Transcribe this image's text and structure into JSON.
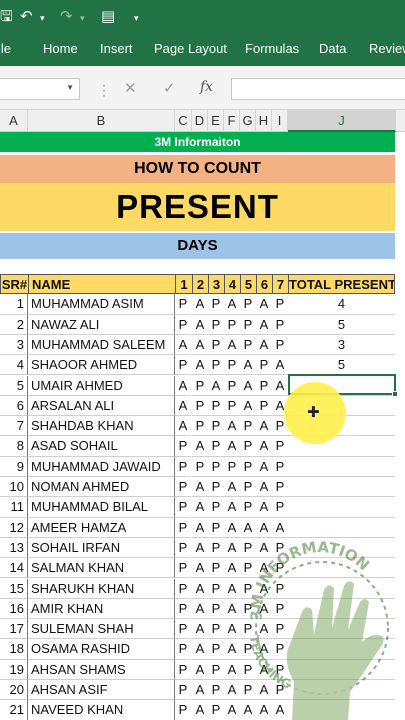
{
  "quick_access": {
    "save_icon": "save-icon",
    "undo_icon": "undo-icon",
    "redo_icon": "redo-icon",
    "form_icon": "form-icon",
    "customize_icon": "customize-qat-icon"
  },
  "ribbon": {
    "tabs": [
      "ile",
      "Home",
      "Insert",
      "Page Layout",
      "Formulas",
      "Data",
      "Review"
    ]
  },
  "formula_bar": {
    "name_box": "",
    "cancel_icon": "✕",
    "enter_icon": "✓",
    "fx_label": "fx",
    "value": ""
  },
  "columns": [
    "A",
    "B",
    "C",
    "D",
    "E",
    "F",
    "G",
    "H",
    "I",
    "J"
  ],
  "sheet": {
    "brand": "3M Informaiton",
    "line1": "HOW TO COUNT",
    "line2": "PRESENT",
    "line3": "DAYS",
    "headers": [
      "SR#",
      "NAME",
      "1",
      "2",
      "3",
      "4",
      "5",
      "6",
      "7",
      "TOTAL PRESENT"
    ],
    "rows": [
      {
        "sr": "1",
        "name": "MUHAMMAD ASIM",
        "days": [
          "P",
          "A",
          "P",
          "A",
          "P",
          "A",
          "P"
        ],
        "total": "4"
      },
      {
        "sr": "2",
        "name": "NAWAZ ALI",
        "days": [
          "P",
          "A",
          "P",
          "P",
          "P",
          "A",
          "P"
        ],
        "total": "5"
      },
      {
        "sr": "3",
        "name": "MUHAMMAD SALEEM",
        "days": [
          "A",
          "A",
          "P",
          "A",
          "P",
          "A",
          "P"
        ],
        "total": "3"
      },
      {
        "sr": "4",
        "name": "SHAOOR AHMED",
        "days": [
          "P",
          "A",
          "P",
          "P",
          "A",
          "P",
          "A"
        ],
        "total": "5"
      },
      {
        "sr": "5",
        "name": "UMAIR AHMED",
        "days": [
          "A",
          "P",
          "A",
          "P",
          "A",
          "P",
          "A"
        ],
        "total": ""
      },
      {
        "sr": "6",
        "name": "ARSALAN ALI",
        "days": [
          "A",
          "P",
          "P",
          "P",
          "A",
          "P",
          "A"
        ],
        "total": ""
      },
      {
        "sr": "7",
        "name": "SHAHDAB KHAN",
        "days": [
          "A",
          "P",
          "P",
          "A",
          "P",
          "A",
          "P"
        ],
        "total": ""
      },
      {
        "sr": "8",
        "name": "ASAD SOHAIL",
        "days": [
          "P",
          "A",
          "P",
          "A",
          "P",
          "A",
          "P"
        ],
        "total": ""
      },
      {
        "sr": "9",
        "name": "MUHAMMAD JAWAID",
        "days": [
          "P",
          "P",
          "P",
          "P",
          "P",
          "A",
          "P"
        ],
        "total": ""
      },
      {
        "sr": "10",
        "name": "NOMAN AHMED",
        "days": [
          "P",
          "A",
          "P",
          "A",
          "P",
          "A",
          "P"
        ],
        "total": ""
      },
      {
        "sr": "11",
        "name": "MUHAMMAD BILAL",
        "days": [
          "P",
          "A",
          "P",
          "A",
          "P",
          "A",
          "P"
        ],
        "total": ""
      },
      {
        "sr": "12",
        "name": "AMEER HAMZA",
        "days": [
          "P",
          "A",
          "P",
          "A",
          "A",
          "A",
          "A"
        ],
        "total": ""
      },
      {
        "sr": "13",
        "name": "SOHAIL IRFAN",
        "days": [
          "P",
          "A",
          "P",
          "A",
          "P",
          "A",
          "P"
        ],
        "total": ""
      },
      {
        "sr": "14",
        "name": "SALMAN KHAN",
        "days": [
          "P",
          "A",
          "P",
          "A",
          "P",
          "A",
          "P"
        ],
        "total": ""
      },
      {
        "sr": "15",
        "name": "SHARUKH KHAN",
        "days": [
          "P",
          "A",
          "P",
          "A",
          "P",
          "A",
          "P"
        ],
        "total": ""
      },
      {
        "sr": "16",
        "name": "AMIR KHAN",
        "days": [
          "P",
          "A",
          "P",
          "A",
          "P",
          "A",
          "P"
        ],
        "total": ""
      },
      {
        "sr": "17",
        "name": "SULEMAN SHAH",
        "days": [
          "P",
          "A",
          "P",
          "A",
          "P",
          "A",
          "P"
        ],
        "total": ""
      },
      {
        "sr": "18",
        "name": "OSAMA RASHID",
        "days": [
          "P",
          "A",
          "P",
          "A",
          "P",
          "A",
          "P"
        ],
        "total": ""
      },
      {
        "sr": "19",
        "name": "AHSAN SHAMS",
        "days": [
          "P",
          "A",
          "P",
          "A",
          "P",
          "A",
          "P"
        ],
        "total": ""
      },
      {
        "sr": "20",
        "name": "AHSAN ASIF",
        "days": [
          "P",
          "A",
          "P",
          "A",
          "P",
          "A",
          "P"
        ],
        "total": ""
      },
      {
        "sr": "21",
        "name": "NAVEED KHAN",
        "days": [
          "P",
          "A",
          "P",
          "A",
          "A",
          "A",
          "A"
        ],
        "total": ""
      }
    ]
  },
  "watermark": {
    "arc_text": "3M INFORMATION",
    "sub_text": "TEACHING"
  },
  "colors": {
    "excel_green": "#217346",
    "brand_bg": "#00b050",
    "orange": "#f4b183",
    "yellow": "#ffd966",
    "blue": "#9dc3e6"
  }
}
